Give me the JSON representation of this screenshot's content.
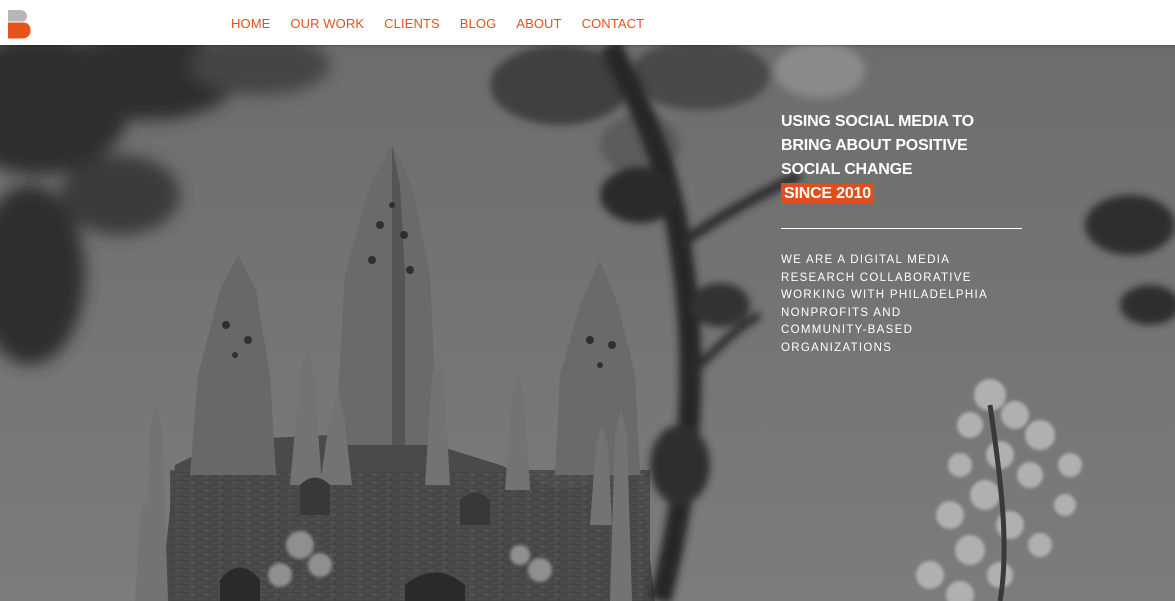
{
  "header": {
    "logo_icon": "b-letter-logo-icon",
    "nav": [
      {
        "label": "HOME"
      },
      {
        "label": "OUR WORK"
      },
      {
        "label": "CLIENTS"
      },
      {
        "label": "BLOG"
      },
      {
        "label": "ABOUT"
      },
      {
        "label": "CONTACT"
      }
    ]
  },
  "hero": {
    "tagline_lines": [
      "USING SOCIAL MEDIA TO",
      "BRING ABOUT POSITIVE",
      "SOCIAL CHANGE"
    ],
    "tagline_highlight": "SINCE 2010",
    "description_lines": [
      "WE ARE A DIGITAL MEDIA",
      "RESEARCH COLLABORATIVE",
      "WORKING WITH PHILADELPHIA",
      "NONPROFITS AND",
      "COMMUNITY-BASED",
      "ORGANIZATIONS"
    ],
    "background": "black-and-white-photo-gothic-tower-with-blossoms"
  },
  "colors": {
    "accent": "#e2511c",
    "highlight_bg": "#e04e1b",
    "header_bg": "#ffffff",
    "hero_text": "#ffffff"
  }
}
